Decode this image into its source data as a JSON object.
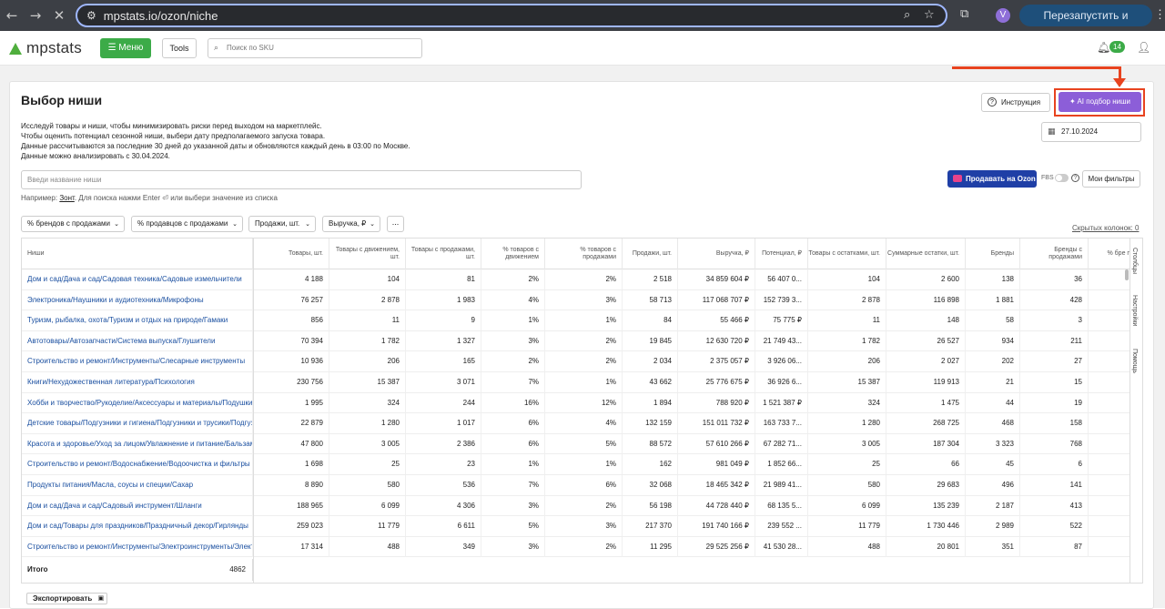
{
  "browser": {
    "url": "mpstats.io/ozon/niche",
    "relaunch_label": "Перезапустить и обновить",
    "profile_initial": "V"
  },
  "header": {
    "logo_text": "mpstats",
    "menu_label": "Меню",
    "tools_label": "Tools",
    "sku_placeholder": "Поиск по SKU",
    "notifications_count": "14"
  },
  "page": {
    "title": "Выбор ниши",
    "description": [
      "Исследуй товары и ниши, чтобы минимизировать риски перед выходом на маркетплейс.",
      "Чтобы оценить потенциал сезонной ниши, выбери дату предполагаемого запуска товара.",
      "Данные рассчитываются за последние 30 дней до указанной даты и обновляются каждый день в 03:00 по Москве.",
      "Данные можно анализировать с 30.04.2024."
    ],
    "instruction_label": "Инструкция",
    "ai_button_label": "AI подбор ниши",
    "date_value": "27.10.2024",
    "niche_placeholder": "Введи название ниши",
    "example_prefix": "Например:",
    "example_link": "Зонт",
    "example_suffix": ". Для поиска нажми Enter ⏎ или выбери значение из списка",
    "sell_on_ozon_label": "Продавать на Ozon",
    "fbs_label": "FBS",
    "my_filters_label": "Мои фильтры",
    "hidden_columns_label": "Скрытых колонок: 0",
    "export_label": "Экспортировать",
    "accent_color": "#8c5ed8",
    "highlight_color": "#e8431f"
  },
  "filters": [
    {
      "label": "% брендов с продажами"
    },
    {
      "label": "% продавцов с продажами"
    },
    {
      "label": "Продажи, шт."
    },
    {
      "label": "Выручка, ₽"
    }
  ],
  "more_label": "...",
  "side_tabs": [
    "Столбцы",
    "Настройки",
    "Помощь"
  ],
  "table": {
    "columns": [
      "Ниши",
      "Товары, шт.",
      "Товары с движением, шт.",
      "Товары с продажами, шт.",
      "% товаров с движением",
      "% товаров с продажами",
      "Продажи, шт.",
      "Выручка, ₽",
      "Потенциал, ₽",
      "Товары с остатками, шт.",
      "Суммарные остатки, шт.",
      "Бренды",
      "Бренды с продажами",
      "% бре про"
    ],
    "rows": [
      [
        "Дом и сад/Дача и сад/Садовая техника/Садовые измельчители",
        "4 188",
        "104",
        "81",
        "2%",
        "2%",
        "2 518",
        "34 859 604 ₽",
        "56 407 0...",
        "104",
        "2 600",
        "138",
        "36"
      ],
      [
        "Электроника/Наушники и аудиотехника/Микрофоны",
        "76 257",
        "2 878",
        "1 983",
        "4%",
        "3%",
        "58 713",
        "117 068 707 ₽",
        "152 739 3...",
        "2 878",
        "116 898",
        "1 881",
        "428"
      ],
      [
        "Туризм, рыбалка, охота/Туризм и отдых на природе/Гамаки",
        "856",
        "11",
        "9",
        "1%",
        "1%",
        "84",
        "55 466 ₽",
        "75 775 ₽",
        "11",
        "148",
        "58",
        "3"
      ],
      [
        "Автотовары/Автозапчасти/Система выпуска/Глушители",
        "70 394",
        "1 782",
        "1 327",
        "3%",
        "2%",
        "19 845",
        "12 630 720 ₽",
        "21 749 43...",
        "1 782",
        "26 527",
        "934",
        "211"
      ],
      [
        "Строительство и ремонт/Инструменты/Слесарные инструменты",
        "10 936",
        "206",
        "165",
        "2%",
        "2%",
        "2 034",
        "2 375 057 ₽",
        "3 926 06...",
        "206",
        "2 027",
        "202",
        "27"
      ],
      [
        "Книги/Нехудожественная литература/Психология",
        "230 756",
        "15 387",
        "3 071",
        "7%",
        "1%",
        "43 662",
        "25 776 675 ₽",
        "36 926 6...",
        "15 387",
        "119 913",
        "21",
        "15"
      ],
      [
        "Хобби и творчество/Рукоделие/Аксессуары и материалы/Подушки",
        "1 995",
        "324",
        "244",
        "16%",
        "12%",
        "1 894",
        "788 920 ₽",
        "1 521 387 ₽",
        "324",
        "1 475",
        "44",
        "19"
      ],
      [
        "Детские товары/Подгузники и гигиена/Подгузники и трусики/Подгузники",
        "22 879",
        "1 280",
        "1 017",
        "6%",
        "4%",
        "132 159",
        "151 011 732 ₽",
        "163 733 7...",
        "1 280",
        "268 725",
        "468",
        "158"
      ],
      [
        "Красота и здоровье/Уход за лицом/Увлажнение и питание/Бальзамы",
        "47 800",
        "3 005",
        "2 386",
        "6%",
        "5%",
        "88 572",
        "57 610 266 ₽",
        "67 282 71...",
        "3 005",
        "187 304",
        "3 323",
        "768"
      ],
      [
        "Строительство и ремонт/Водоснабжение/Водоочистка и фильтры",
        "1 698",
        "25",
        "23",
        "1%",
        "1%",
        "162",
        "981 049 ₽",
        "1 852 66...",
        "25",
        "66",
        "45",
        "6"
      ],
      [
        "Продукты питания/Масла, соусы и специи/Сахар",
        "8 890",
        "580",
        "536",
        "7%",
        "6%",
        "32 068",
        "18 465 342 ₽",
        "21 989 41...",
        "580",
        "29 683",
        "496",
        "141"
      ],
      [
        "Дом и сад/Дача и сад/Садовый инструмент/Шланги",
        "188 965",
        "6 099",
        "4 306",
        "3%",
        "2%",
        "56 198",
        "44 728 440 ₽",
        "68 135 5...",
        "6 099",
        "135 239",
        "2 187",
        "413"
      ],
      [
        "Дом и сад/Товары для праздников/Праздничный декор/Гирлянды",
        "259 023",
        "11 779",
        "6 611",
        "5%",
        "3%",
        "217 370",
        "191 740 166 ₽",
        "239 552 ...",
        "11 779",
        "1 730 446",
        "2 989",
        "522"
      ],
      [
        "Строительство и ремонт/Инструменты/Электроинструменты/Электролобзики",
        "17 314",
        "488",
        "349",
        "3%",
        "2%",
        "11 295",
        "29 525 256 ₽",
        "41 530 28...",
        "488",
        "20 801",
        "351",
        "87"
      ]
    ],
    "total_label": "Итого",
    "total_value": "4862"
  }
}
